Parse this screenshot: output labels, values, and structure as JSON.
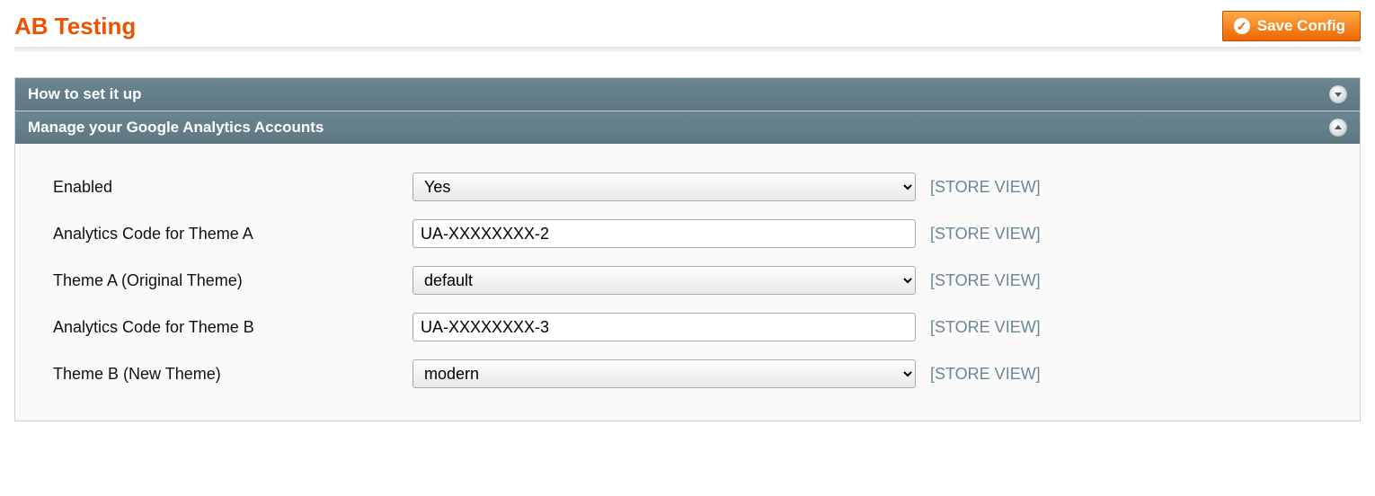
{
  "header": {
    "title": "AB Testing",
    "save_label": "Save Config"
  },
  "scope_label": "[STORE VIEW]",
  "sections": {
    "setup": {
      "title": "How to set it up"
    },
    "ga": {
      "title": "Manage your Google Analytics Accounts"
    }
  },
  "fields": {
    "enabled": {
      "label": "Enabled",
      "value": "Yes"
    },
    "code_a": {
      "label": "Analytics Code for Theme A",
      "value": "UA-XXXXXXXX-2"
    },
    "theme_a": {
      "label": "Theme A (Original Theme)",
      "value": "default"
    },
    "code_b": {
      "label": "Analytics Code for Theme B",
      "value": "UA-XXXXXXXX-3"
    },
    "theme_b": {
      "label": "Theme B (New Theme)",
      "value": "modern"
    }
  }
}
